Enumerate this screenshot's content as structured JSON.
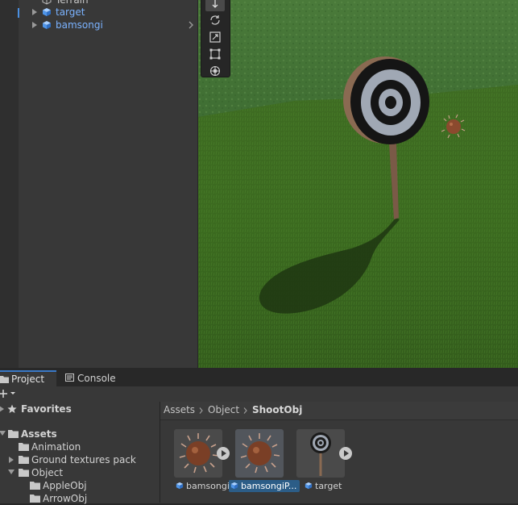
{
  "hierarchy": {
    "items": [
      {
        "label": "Terrain",
        "color": "gray"
      },
      {
        "label": "target",
        "color": "blue"
      },
      {
        "label": "bamsongi",
        "color": "blue"
      }
    ]
  },
  "scene": {
    "tools": [
      "move-tool-icon",
      "rotate-tool-icon",
      "scale-tool-icon",
      "rect-tool-icon",
      "transform-tool-icon"
    ]
  },
  "project_panel": {
    "tabs": [
      {
        "label": "Project",
        "active": true
      },
      {
        "label": "Console",
        "active": false
      }
    ],
    "favorites_label": "Favorites",
    "tree": {
      "assets": "Assets",
      "animation": "Animation",
      "ground": "Ground textures pack",
      "object": "Object",
      "apple": "AppleObj",
      "arrow": "ArrowObj"
    },
    "breadcrumb": [
      "Assets",
      "Object",
      "ShootObj"
    ],
    "assets": [
      {
        "label": "bamsongi",
        "selected": false
      },
      {
        "label": "bamsongiP...",
        "selected": true
      },
      {
        "label": "target",
        "selected": false
      }
    ]
  },
  "colors": {
    "accent": "#3a79c7",
    "selection": "#2c5d87",
    "prefab_blue": "#7bb3ff"
  }
}
